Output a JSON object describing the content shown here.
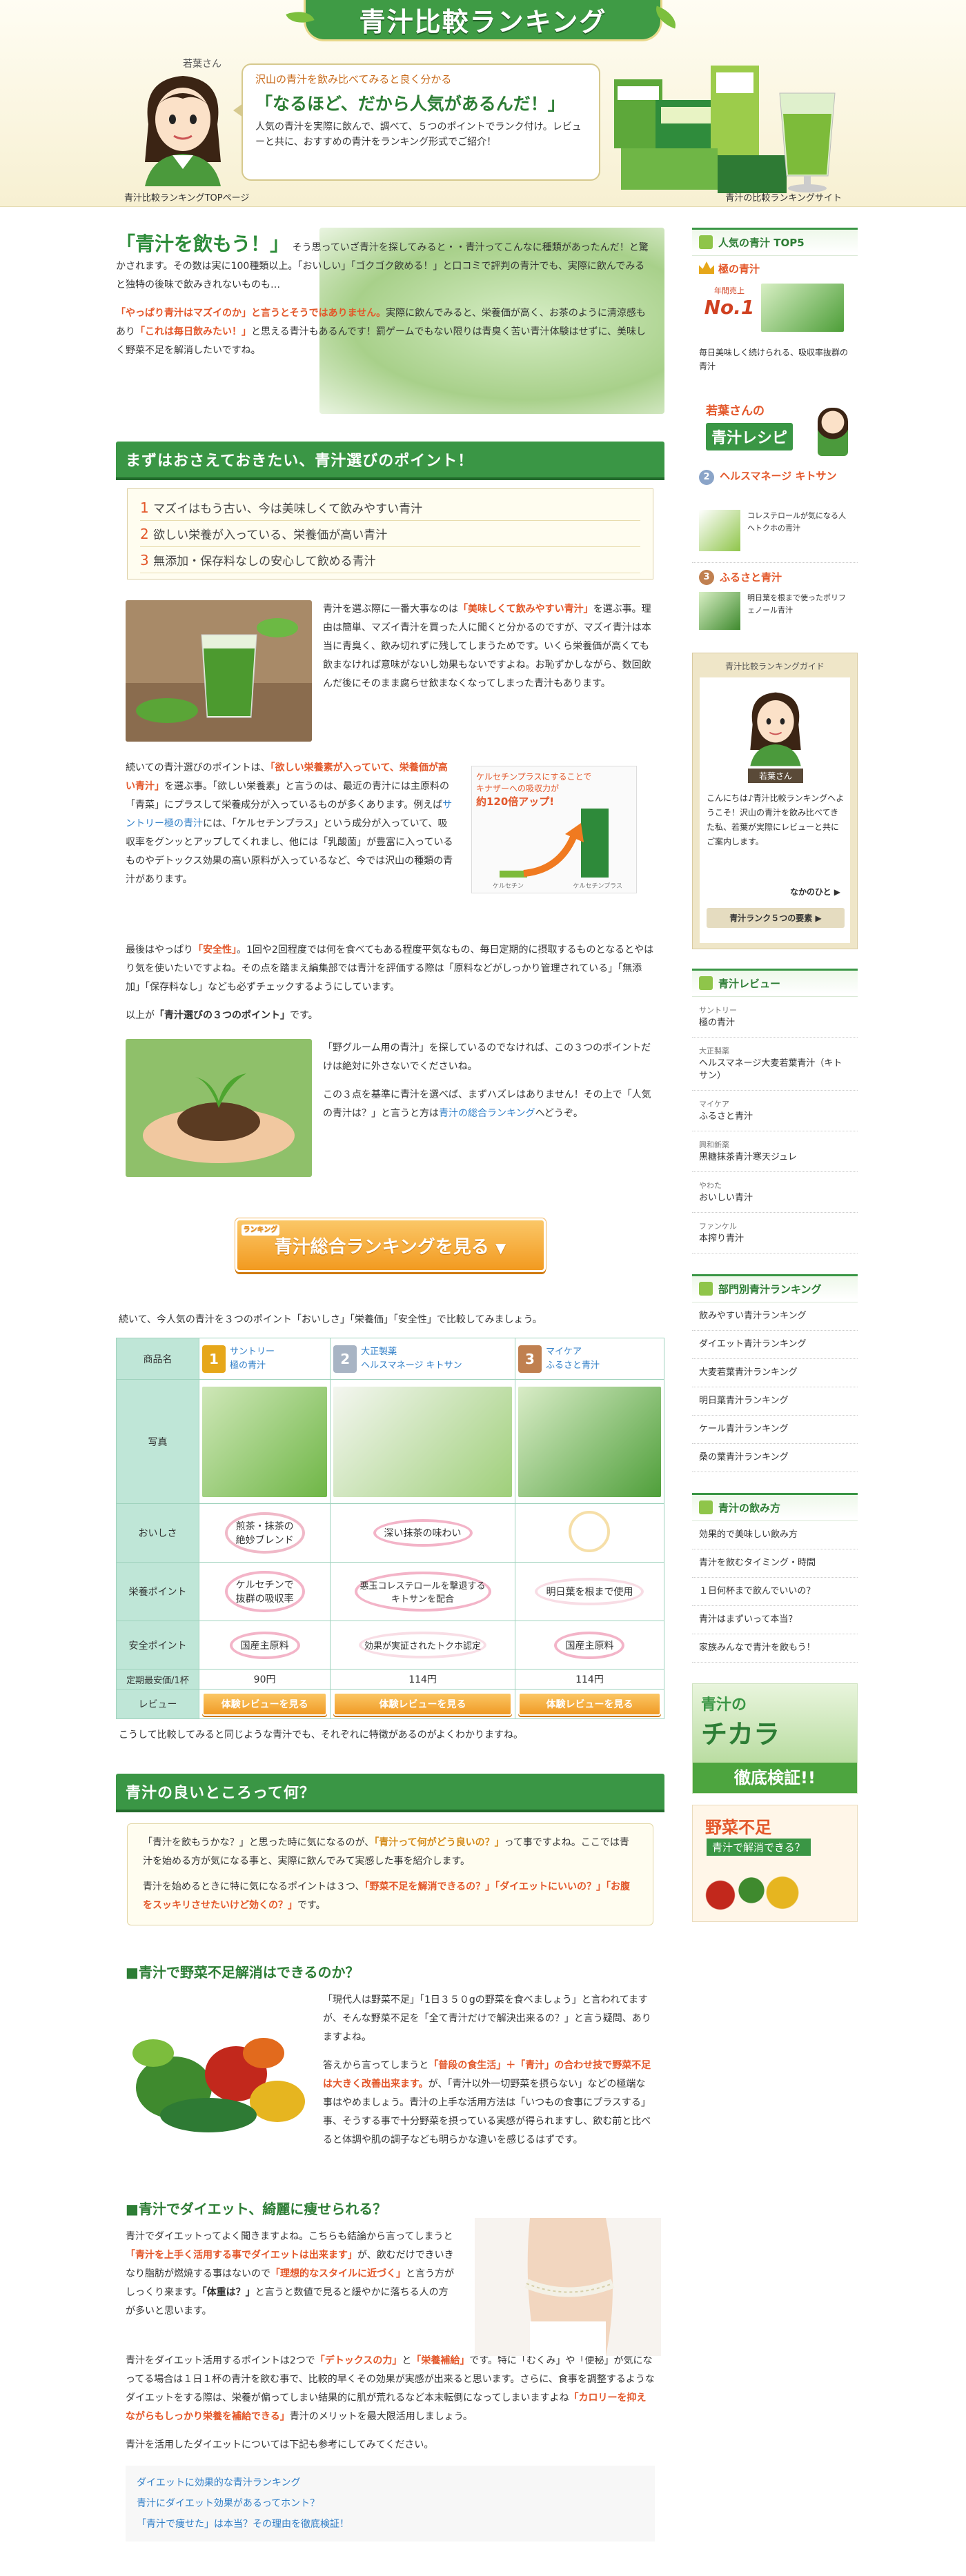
{
  "header": {
    "logo": "青汁比較ランキング",
    "mascot_name": "若葉さん",
    "bubble_small": "沢山の青汁を飲み比べてみると良く分かる",
    "bubble_big": "「なるほど、だから人気があるんだ！」",
    "bubble_body": "人気の青汁を実際に飲んで、調べて、５つのポイントでランク付け。レビューと共に、おすすめの青汁をランキング形式でご紹介！",
    "top_link": "青汁比較ランキングTOPページ",
    "site_name": "青汁の比較ランキングサイト"
  },
  "intro": {
    "lead": "「青汁を飲もう！」",
    "lead_rest": "そう思っていざ青汁を探してみると・・青汁ってこんなに種類があったんだ！と驚かされます。その数は実に100種類以上。「おいしい」「ゴクゴク飲める！」と口コミで評判の青汁でも、実際に飲んでみると独特の後味で飲みきれないものも…",
    "p2a": "「やっぱり青汁はマズイのか」と言うとそうではありません。",
    "p2b": "実際に飲んでみると、栄養価が高く、お茶のように清涼感もあり",
    "p2c": "「これは毎日飲みたい！」",
    "p2d": "と思える青汁もあるんです！罰ゲームでもない限りは青臭く苦い青汁体験はせずに、美味しく野菜不足を解消したいですね。"
  },
  "points": {
    "title": "まずはおさえておきたい、青汁選びのポイント！",
    "items": [
      "マズイはもう古い、今は美味しくて飲みやすい青汁",
      "欲しい栄養が入っている、栄養価が高い青汁",
      "無添加・保存料なしの安心して飲める青汁"
    ]
  },
  "body1": {
    "a": "青汁を選ぶ際に一番大事なのは",
    "b": "「美味しくて飲みやすい青汁」",
    "c": "を選ぶ事。理由は簡単、マズイ青汁を買った人に聞くと分かるのですが、マズイ青汁は本当に青臭く、飲み切れずに残してしまうためです。いくら栄養価が高くても飲まなければ意味がないし効果もないですよね。お恥ずかしながら、数回飲んだ後にそのまま腐らせ飲まなくなってしまった青汁もあります。"
  },
  "body2": {
    "a": "続いての青汁選びのポイントは、",
    "b": "「欲しい栄養素が入っていて、栄養価が高い青汁」",
    "c": "を選ぶ事。「欲しい栄養素」と言うのは、最近の青汁には主原料の「青菜」にプラスして栄養成分が入っているものが多くあります。例えば",
    "d": "サントリー極の青汁",
    "e": "には、「ケルセチンプラス」という成分が入っていて、吸収率をグンッとアップしてくれまし、他には「乳酸菌」が豊富に入っているものやデトックス効果の高い原料が入っているなど、今では沢山の種類の青汁があります。",
    "chart_line1": "ケルセチンプラスにすることで",
    "chart_line2": "キナザーへの吸収力が",
    "chart_big": "約120倍アップ!",
    "chart_x1": "ケルセチン",
    "chart_x2": "ケルセチンプラス"
  },
  "body3": {
    "a": "最後はやっぱり",
    "b": "「安全性」",
    "c": "。1回や2回程度では何を食べてもある程度平気なもの、毎日定期的に摂取するものとなるとやはり気を使いたいですよね。その点を踏まえ編集部では青汁を評価する際は「原料などがしっかり管理されている」「無添加」「保存料なし」なども必ずチェックするようにしています。",
    "d": "以上が",
    "e": "「青汁選びの３つのポイント」",
    "f": "です。"
  },
  "body4": {
    "a": "「野グルーム用の青汁」を探しているのでなければ、この３つのポイントだけは絶対に外さないでくださいね。",
    "b": "この３点を基準に青汁を選べば、まずハズレはありません！その上で「人気の青汁は？」と言うと方は",
    "c": "青汁の総合ランキング",
    "d": "へどうぞ。"
  },
  "cta": {
    "label": "青汁総合ランキングを見る",
    "badge": "ランキング"
  },
  "compare": {
    "intro": "続いて、今人気の青汁を３つのポイント「おいしさ」「栄養価」「安全性」で比較してみましょう。",
    "header_label": "商品名",
    "products": [
      {
        "rank": "1",
        "maker": "サントリー",
        "name": "極の青汁"
      },
      {
        "rank": "2",
        "maker": "大正製薬",
        "name": "ヘルスマネージ キトサン"
      },
      {
        "rank": "3",
        "maker": "マイケア",
        "name": "ふるさと青汁"
      }
    ],
    "rows": {
      "photo": "写真",
      "taste": "おいしさ",
      "nutrition": "栄養ポイント",
      "safety": "安全ポイント",
      "price": "定期最安価/1杯",
      "review": "レビュー"
    },
    "taste": [
      "煎茶・抹茶の\n絶妙ブレンド",
      "深い抹茶の味わい",
      ""
    ],
    "nutrition": [
      "ケルセチンで\n抜群の吸収率",
      "悪玉コレステロールを撃退する\nキトサンを配合",
      "明日葉を根まで使用"
    ],
    "safety": [
      "国産主原料",
      "効果が実証されたトクホ認定",
      "国産主原料"
    ],
    "price": [
      "90円",
      "114円",
      "114円"
    ],
    "review_btn": "体験レビューを見る",
    "outro": "こうして比較してみると同じような青汁でも、それぞれに特徴があるのがよくわかりますね。"
  },
  "good": {
    "title": "青汁の良いところって何？",
    "box_a": "「青汁を飲もうかな？」と思った時に気になるのが、",
    "box_b": "「青汁って何がどう良いの？」",
    "box_c": "って事ですよね。ここでは青汁を始める方が気になる事と、実際に飲んでみて実感した事を紹介します。",
    "box_d": "青汁を始めるときに特に気になるポイントは３つ、",
    "box_e": "「野菜不足を解消できるの？」「ダイエットにいいの？」「お腹をスッキリさせたいけど効くの？」",
    "box_f": "です。"
  },
  "veg": {
    "title": "■青汁で野菜不足解消はできるのか？",
    "a": "「現代人は野菜不足」「1日３５０gの野菜を食べましょう」と言われてますが、そんな野菜不足を「全て青汁だけで解決出来るの？」と言う疑問、ありますよね。",
    "b": "答えから言ってしまうと",
    "c": "「普段の食生活」＋「青汁」の合わせ技で野菜不足は大きく改善出来ます。",
    "d": "が、「青汁以外一切野菜を摂らない」などの極端な事はやめましょう。青汁の上手な活用方法は「いつもの食事にプラスする」事、そうする事で十分野菜を摂っている実感が得られますし、飲む前と比べると体調や肌の調子なども明らかな違いを感じるはずです。"
  },
  "diet": {
    "title": "■青汁でダイエット、綺麗に痩せられる？",
    "a": "青汁でダイエットってよく聞きますよね。こちらも結論から言ってしまうと",
    "b": "「青汁を上手く活用する事でダイエットは出来ます」",
    "c": "が、飲むだけできいきなり脂肪が燃焼する事はないので",
    "d": "「理想的なスタイルに近づく」",
    "e": "と言う方がしっくり来ます。",
    "f": "「体重は？」",
    "g": "と言うと数値で見ると緩やかに落ちる人の方が多いと思います。",
    "h": "青汁をダイエット活用するポイントは2つで",
    "i": "「デトックスの力」",
    "j": "と",
    "k": "「栄養補給」",
    "l": "です。特に「むくみ」や「便秘」が気になってる場合は１日１杯の青汁を飲む事で、比較的早くその効果が実感が出来ると思います。さらに、食事を調整するようなダイエットをする際は、栄養が偏ってしまい結果的に肌が荒れるなど本末転倒になってしまいますよね",
    "m": "「カロリーを抑えながらもしっかり栄養を補給できる」",
    "n": "青汁のメリットを最大限活用しましょう。",
    "o": "青汁を活用したダイエットについては下記も参考にしてみてください。",
    "links": [
      "ダイエットに効果的な青汁ランキング",
      "青汁にダイエット効果があるってホント？",
      "「青汁で痩せた」は本当？その理由を徹底検証！"
    ]
  },
  "sidebar": {
    "top5_title": "人気の青汁 TOP5",
    "rank1_name": "極の青汁",
    "rank1_badge_small": "年間売上",
    "rank1_badge_big": "No.1",
    "rank1_desc": "毎日美味しく続けられる、吸収率抜群の青汁",
    "recipe_line1": "若葉さんの",
    "recipe_line2": "青汁レシピ",
    "rank2_name": "ヘルスマネージ キトサン",
    "rank2_desc": "コレステロールが気になる人へトクホの青汁",
    "rank3_name": "ふるさと青汁",
    "rank3_desc": "明日葉を根まで使ったポリフェノール青汁",
    "guide_title": "青汁比較ランキングガイド",
    "guide_name": "若葉さん",
    "guide_text": "こんにちは♪青汁比較ランキングへようこそ！沢山の青汁を飲み比べてきた私、若葉が実際にレビューと共にご案内します。",
    "guide_more": "なかのひと ▶",
    "guide_btn": "青汁ランク５つの要素 ▶",
    "review_title": "青汁レビュー",
    "reviews": [
      {
        "maker": "サントリー",
        "name": "極の青汁"
      },
      {
        "maker": "大正製薬",
        "name": "ヘルスマネージ大麦若葉青汁（キトサン）"
      },
      {
        "maker": "マイケア",
        "name": "ふるさと青汁"
      },
      {
        "maker": "興和新薬",
        "name": "黒糖抹茶青汁寒天ジュレ"
      },
      {
        "maker": "やわた",
        "name": "おいしい青汁"
      },
      {
        "maker": "ファンケル",
        "name": "本搾り青汁"
      }
    ],
    "dept_title": "部門別青汁ランキング",
    "depts": [
      "飲みやすい青汁ランキング",
      "ダイエット青汁ランキング",
      "大麦若葉青汁ランキング",
      "明日葉青汁ランキング",
      "ケール青汁ランキング",
      "桑の葉青汁ランキング"
    ],
    "how_title": "青汁の飲み方",
    "hows": [
      "効果的で美味しい飲み方",
      "青汁を飲むタイミング・時間",
      "１日何杯まで飲んでいいの？",
      "青汁はまずいって本当？",
      "家族みんなで青汁を飲もう！"
    ],
    "banner1_a": "青汁の",
    "banner1_b": "チカラ",
    "banner1_c": "徹底検証!!",
    "banner2_a": "野菜不足",
    "banner2_b": "青汁で解消できる？"
  },
  "colors": {
    "green": "#3a9645",
    "orange": "#f09a25",
    "red": "#e3572a"
  }
}
